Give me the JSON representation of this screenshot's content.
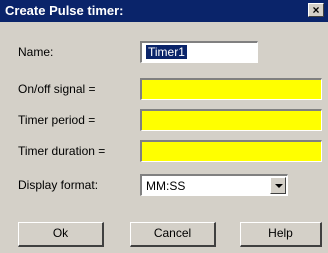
{
  "dialog": {
    "title": "Create Pulse timer:",
    "close_symbol": "×"
  },
  "fields": {
    "name_label": "Name:",
    "name_value": "Timer1",
    "onoff_label": "On/off signal =",
    "onoff_value": "",
    "period_label": "Timer period =",
    "period_value": "",
    "duration_label": "Timer duration =",
    "duration_value": "",
    "format_label": "Display format:",
    "format_value": "MM:SS"
  },
  "buttons": {
    "ok": "Ok",
    "cancel": "Cancel",
    "help": "Help"
  },
  "colors": {
    "title_bar": "#0a246a",
    "field_highlight": "#ffff00",
    "dialog_bg": "#d4d0c8"
  }
}
